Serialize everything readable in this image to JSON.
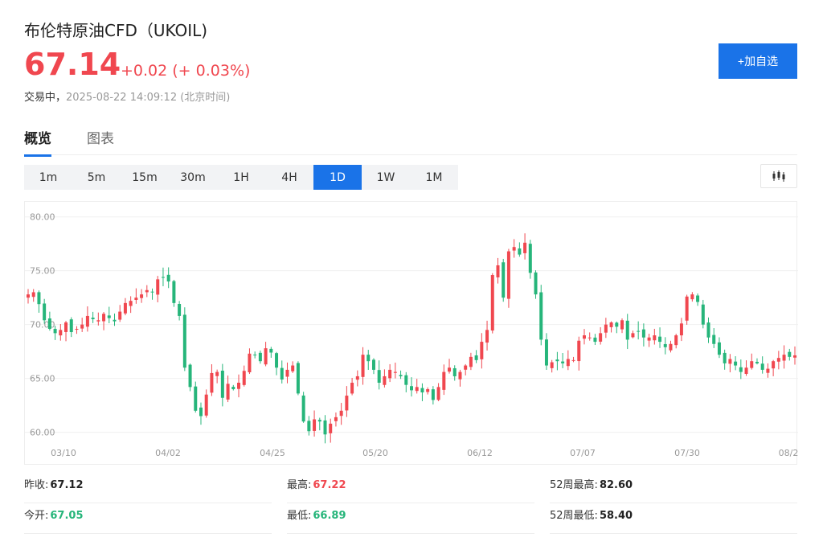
{
  "header": {
    "title": "布伦特原油CFD（UKOIL)",
    "price": "67.14",
    "change": "+0.02 (+ 0.03%)",
    "status_label": "交易中，",
    "timestamp": "2025-08-22 14:09:12 (北京时间)",
    "add_button": "+加自选"
  },
  "tabs": [
    {
      "label": "概览",
      "active": true
    },
    {
      "label": "图表",
      "active": false
    }
  ],
  "intervals": [
    {
      "label": "1m"
    },
    {
      "label": "5m"
    },
    {
      "label": "15m"
    },
    {
      "label": "30m"
    },
    {
      "label": "1H"
    },
    {
      "label": "4H"
    },
    {
      "label": "1D",
      "active": true
    },
    {
      "label": "1W"
    },
    {
      "label": "1M"
    }
  ],
  "chart_type_icon": "candlestick-icon",
  "colors": {
    "up": "#f0474f",
    "down": "#26b57a",
    "accent": "#1a73e8"
  },
  "chart_data": {
    "type": "candlestick",
    "y_ticks": [
      "80.00",
      "75.00",
      "70.00",
      "65.00",
      "60.00"
    ],
    "x_ticks": [
      "03/10",
      "04/02",
      "04/25",
      "05/20",
      "06/12",
      "07/07",
      "07/30",
      "08/2"
    ],
    "ylim": [
      59,
      80.5
    ],
    "grid": true,
    "closes": [
      72.8,
      73.0,
      71.9,
      70.4,
      69.6,
      69.2,
      69.5,
      70.2,
      69.3,
      69.6,
      70.0,
      70.8,
      70.5,
      70.4,
      71.0,
      70.6,
      70.3,
      71.2,
      72.0,
      72.2,
      72.5,
      72.8,
      73.2,
      73.0,
      74.2,
      74.4,
      74.0,
      72.0,
      70.8,
      66.0,
      64.2,
      62.0,
      61.5,
      63.5,
      65.5,
      65.6,
      63.2,
      64.5,
      64.0,
      64.6,
      65.7,
      67.3,
      67.2,
      66.6,
      67.8,
      67.4,
      66.0,
      64.9,
      65.8,
      66.2,
      63.6,
      61.0,
      60.1,
      61.2,
      61.0,
      59.8,
      60.8,
      61.4,
      62.0,
      63.4,
      64.6,
      65.2,
      67.2,
      66.6,
      65.8,
      64.6,
      65.2,
      65.8,
      65.6,
      65.2,
      64.4,
      63.9,
      64.2,
      63.7,
      64.0,
      63.0,
      64.2,
      65.6,
      66.0,
      65.2,
      65.6,
      66.2,
      67.0,
      66.7,
      68.4,
      69.5,
      74.6,
      75.5,
      72.5,
      76.8,
      77.2,
      76.5,
      77.6,
      74.8,
      72.8,
      68.6,
      66.2,
      66.5,
      66.6,
      66.4,
      66.8,
      66.7,
      68.5,
      69.0,
      68.8,
      68.4,
      69.2,
      70.0,
      70.2,
      69.8,
      70.4,
      68.6,
      69.2,
      69.4,
      68.8,
      68.8,
      69.0,
      68.4,
      67.9,
      68.2,
      69.0,
      70.1,
      72.6,
      72.8,
      72.1,
      70.0,
      68.8,
      68.2,
      67.2,
      66.4,
      66.8,
      66.2,
      65.6,
      66.0,
      66.6,
      66.4,
      65.8,
      65.9,
      66.6,
      66.9,
      67.2,
      67.0,
      67.14
    ]
  },
  "stats": {
    "rows": [
      [
        {
          "label": "昨收:",
          "value": "67.12",
          "tone": "plain"
        },
        {
          "label": "最高:",
          "value": "67.22",
          "tone": "up"
        },
        {
          "label": "52周最高:",
          "value": "82.60",
          "tone": "plain"
        }
      ],
      [
        {
          "label": "今开:",
          "value": "67.05",
          "tone": "down"
        },
        {
          "label": "最低:",
          "value": "66.89",
          "tone": "down"
        },
        {
          "label": "52周最低:",
          "value": "58.40",
          "tone": "plain"
        }
      ]
    ]
  }
}
